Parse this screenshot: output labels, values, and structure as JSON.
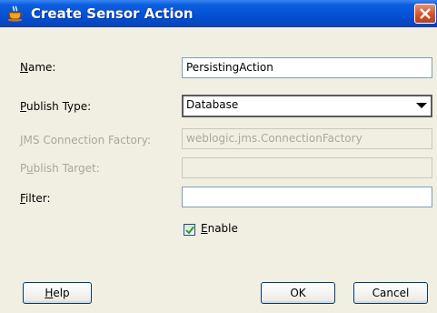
{
  "window": {
    "title": "Create Sensor Action",
    "icon": "cup-icon",
    "close_icon": "close-icon"
  },
  "form": {
    "name": {
      "mnemonic": "N",
      "rest": "ame:",
      "value": "PersistingAction",
      "enabled": true
    },
    "publish_type": {
      "mnemonic": "P",
      "rest": "ublish Type:",
      "value": "Database",
      "enabled": true
    },
    "jms_connection_factory": {
      "pre": "",
      "mnemonic": "J",
      "rest": "MS Connection Factory:",
      "value": "weblogic.jms.ConnectionFactory",
      "enabled": false
    },
    "publish_target": {
      "pre": "P",
      "mnemonic": "u",
      "rest": "blish Target:",
      "value": "",
      "enabled": false
    },
    "filter": {
      "mnemonic": "F",
      "rest": "ilter:",
      "value": "",
      "enabled": true
    },
    "enable": {
      "mnemonic": "E",
      "rest": "nable",
      "checked": true
    }
  },
  "buttons": {
    "help": {
      "mnemonic": "H",
      "rest": "elp"
    },
    "ok": "OK",
    "cancel": "Cancel"
  }
}
